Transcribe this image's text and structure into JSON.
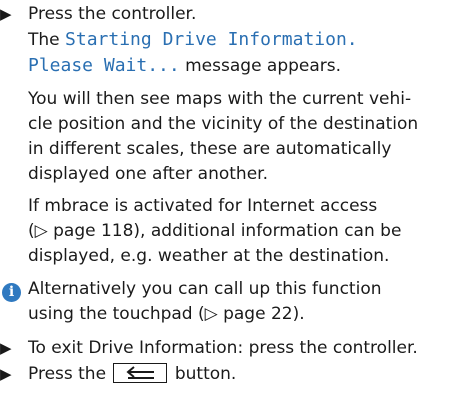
{
  "colors": {
    "message_text": "#2a6fb2",
    "info_icon": "#2f79c0",
    "body_text": "#1a1a1a"
  },
  "step1": {
    "bullet": "▶",
    "text": "Press the controller."
  },
  "message": {
    "line1_pre": "The ",
    "line1_msg": "Starting Drive Information.",
    "line2_msg": "Please Wait...",
    "line2_post": " message appears."
  },
  "para_maps": [
    "You will then see maps with the current vehi-",
    "cle position and the vicinity of the destination",
    "in different scales, these are automatically",
    "displayed one after another."
  ],
  "para_mbrace": [
    "If mbrace is activated for Internet access",
    "(▷ page 118), additional information can be",
    "displayed, e.g. weather at the destination."
  ],
  "info": {
    "icon": "i",
    "icon_name": "info-icon",
    "line1": "Alternatively you can call up this function",
    "line2": "using the touchpad (▷ page 22)."
  },
  "step2": {
    "bullet": "▶",
    "text": "To exit Drive Information: press the controller."
  },
  "step3": {
    "bullet": "▶",
    "pre": "Press the ",
    "button_icon": "back-arrow-icon",
    "post": " button."
  }
}
